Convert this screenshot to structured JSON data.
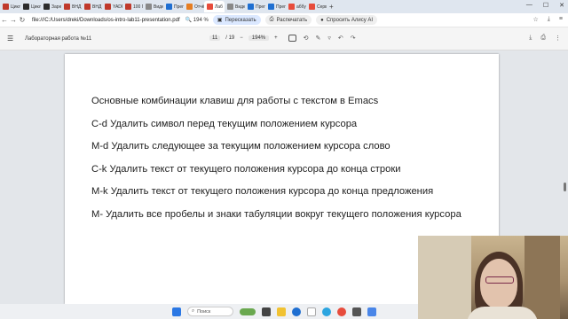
{
  "browser": {
    "tabs": [
      {
        "label": "Цикл",
        "color": "#c0392b"
      },
      {
        "label": "Цикл",
        "color": "#2c2c2c"
      },
      {
        "label": "Заре",
        "color": "#2c2c2c"
      },
      {
        "label": "ВНД Р",
        "color": "#c0392b"
      },
      {
        "label": "ВНД Р",
        "color": "#c0392b"
      },
      {
        "label": "YADR",
        "color": "#c0392b"
      },
      {
        "label": "100 Г",
        "color": "#c0392b"
      },
      {
        "label": "Видео",
        "color": "#888888"
      },
      {
        "label": "Преп",
        "color": "#1f6fd1"
      },
      {
        "label": "Отчё",
        "color": "#e67e22"
      },
      {
        "label": "Лаб",
        "color": "#e74c3c",
        "active": true
      },
      {
        "label": "Видео",
        "color": "#888888"
      },
      {
        "label": "Преп",
        "color": "#1f6fd1"
      },
      {
        "label": "Преп",
        "color": "#1f6fd1"
      },
      {
        "label": "аббу",
        "color": "#e74c3c"
      },
      {
        "label": "Серв",
        "color": "#e74c3c"
      }
    ],
    "url": "file:///C:/Users/dreki/Downloads/os-intro-lab11-presentation.pdf",
    "zoom": "194 %",
    "translate_label": "Пересказать",
    "print_label": "Распечатать",
    "ask_label": "Спросить Алису AI"
  },
  "pdf_toolbar": {
    "title": "Лабораторная работа №11",
    "page_current": "11",
    "page_total": "/ 19",
    "zoom": "194%",
    "minus": "−",
    "plus": "+"
  },
  "slide": {
    "lines": [
      "Основные комбинации клавиш для работы с текстом в Emacs",
      "C-d Удалить символ перед текущим положением курсора",
      "M-d Удалить следующее за текущим положением курсора слово",
      "C-k Удалить текст от текущего положения курсора до конца строки",
      "M-k Удалить текст от текущего положения курсора до конца предложения",
      "M- Удалить все пробелы и знаки табуляции вокруг текущего положения курсора"
    ]
  },
  "taskbar": {
    "search_label": "Поиск"
  }
}
